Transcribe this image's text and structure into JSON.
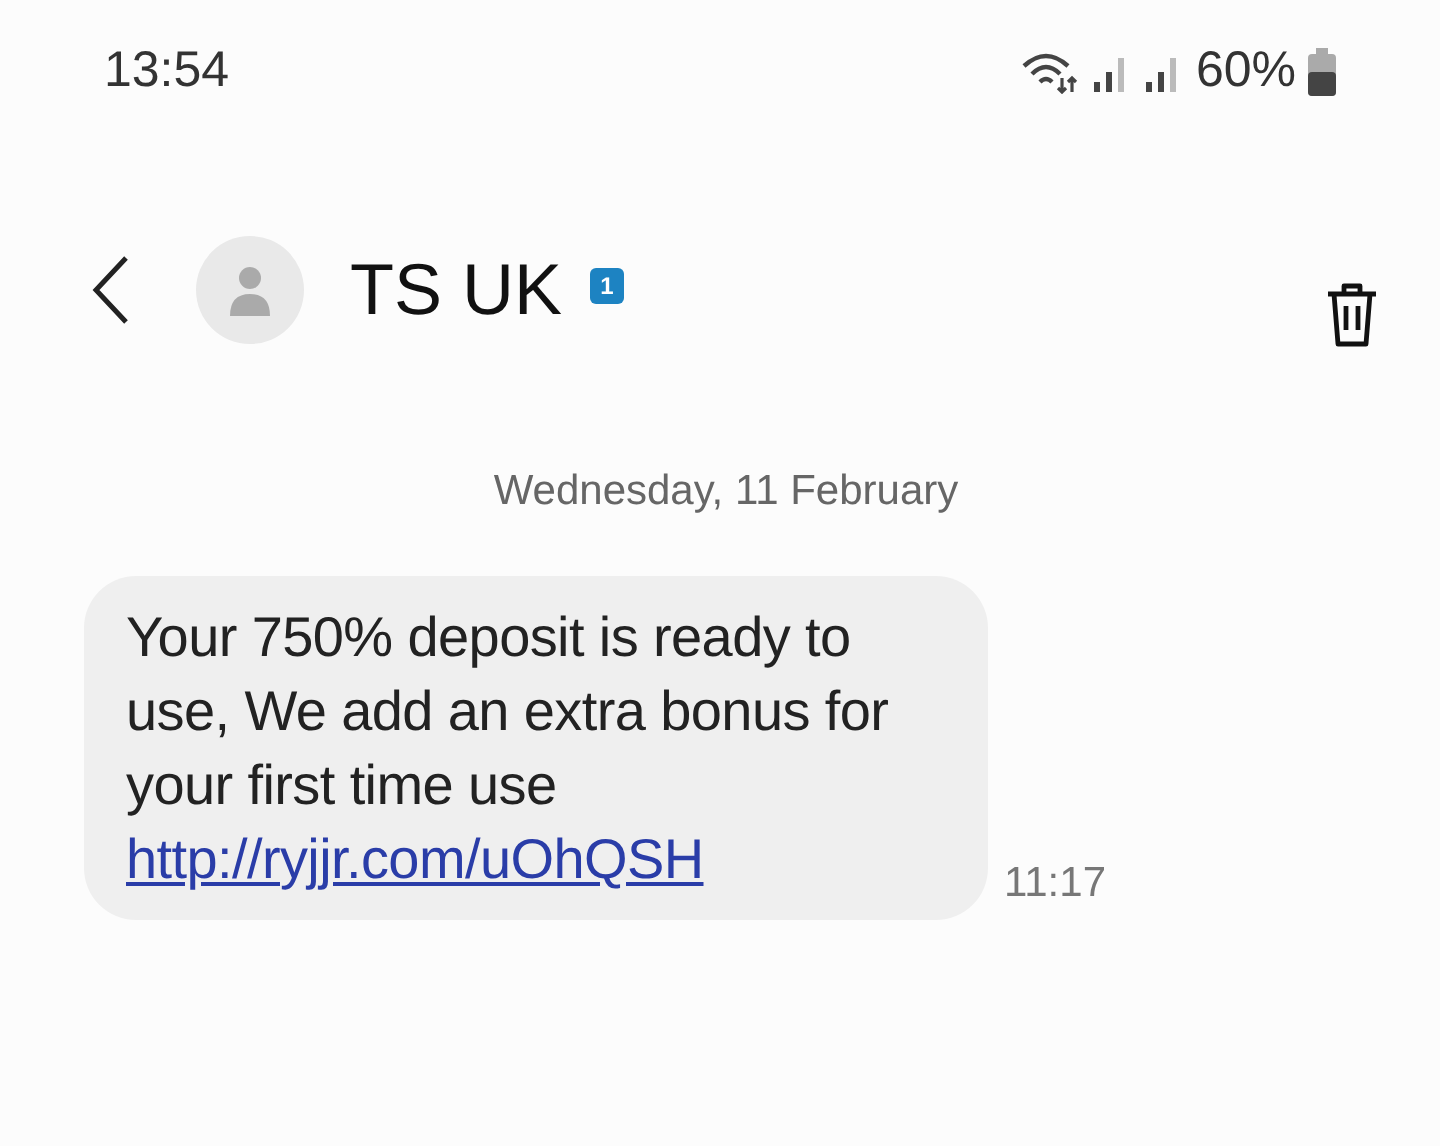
{
  "status_bar": {
    "time": "13:54",
    "battery": "60%"
  },
  "header": {
    "contact": "TS UK",
    "sim_badge": "1"
  },
  "date_divider": "Wednesday, 11 February",
  "messages": [
    {
      "text": "Your 750% deposit is ready to use, We add an extra bonus for your first time use",
      "link": "http://ryjjr.com/uOhQSH",
      "time": "11:17"
    }
  ]
}
